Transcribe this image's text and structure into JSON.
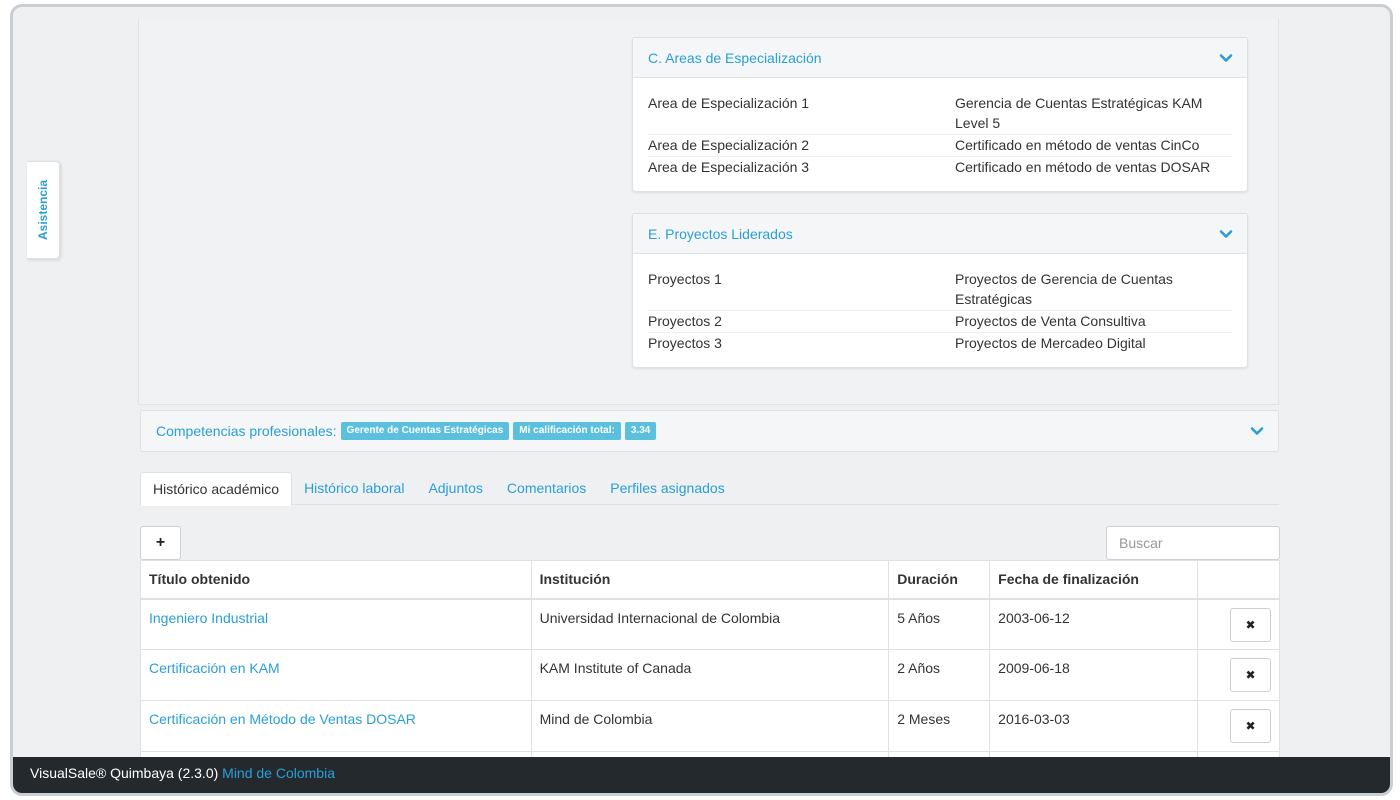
{
  "side_tab": {
    "label": "Asistencia"
  },
  "panels": {
    "areas": {
      "title": "C. Areas de Especialización",
      "rows": [
        {
          "label": "Area de Especialización 1",
          "value": "Gerencia de Cuentas Estratégicas KAM Level 5"
        },
        {
          "label": "Area de Especialización 2",
          "value": "Certificado en método de ventas CinCo"
        },
        {
          "label": "Area de Especialización 3",
          "value": "Certificado en método de ventas DOSAR"
        }
      ]
    },
    "projects": {
      "title": "E. Proyectos Liderados",
      "rows": [
        {
          "label": "Proyectos 1",
          "value": "Proyectos de Gerencia de Cuentas Estratégicas"
        },
        {
          "label": "Proyectos 2",
          "value": "Proyectos de Venta Consultiva"
        },
        {
          "label": "Proyectos 3",
          "value": "Proyectos de Mercadeo Digital"
        }
      ]
    }
  },
  "competencias": {
    "label": "Competencias profesionales:",
    "badges": [
      "Gerente de Cuentas Estratégicas",
      "Mi calificación total:",
      "3.34"
    ]
  },
  "tabs": [
    {
      "label": "Histórico académico",
      "active": true
    },
    {
      "label": "Histórico laboral",
      "active": false
    },
    {
      "label": "Adjuntos",
      "active": false
    },
    {
      "label": "Comentarios",
      "active": false
    },
    {
      "label": "Perfiles asignados",
      "active": false
    }
  ],
  "toolbar": {
    "add_label": "+",
    "search_placeholder": "Buscar",
    "search_value": ""
  },
  "table": {
    "headers": [
      "Título obtenido",
      "Institución",
      "Duración",
      "Fecha de finalización",
      ""
    ],
    "rows": [
      {
        "titulo": "Ingeniero Industrial",
        "institucion": "Universidad Internacional de Colombia",
        "duracion": "5 Años",
        "fecha": "2003-06-12",
        "delete": "✖"
      },
      {
        "titulo": "Certificación en KAM",
        "institucion": "KAM Institute of Canada",
        "duracion": "2 Años",
        "fecha": "2009-06-18",
        "delete": "✖"
      },
      {
        "titulo": "Certificación en Método de Ventas DOSAR",
        "institucion": "Mind de Colombia",
        "duracion": "2 Meses",
        "fecha": "2016-03-03",
        "delete": "✖"
      }
    ]
  },
  "footer": {
    "app": "VisualSale® Quimbaya (2.3.0)",
    "company": "Mind de Colombia"
  },
  "colors": {
    "accent": "#2a9fd6",
    "badge": "#5bc0de",
    "footer_bg": "#24292d"
  }
}
